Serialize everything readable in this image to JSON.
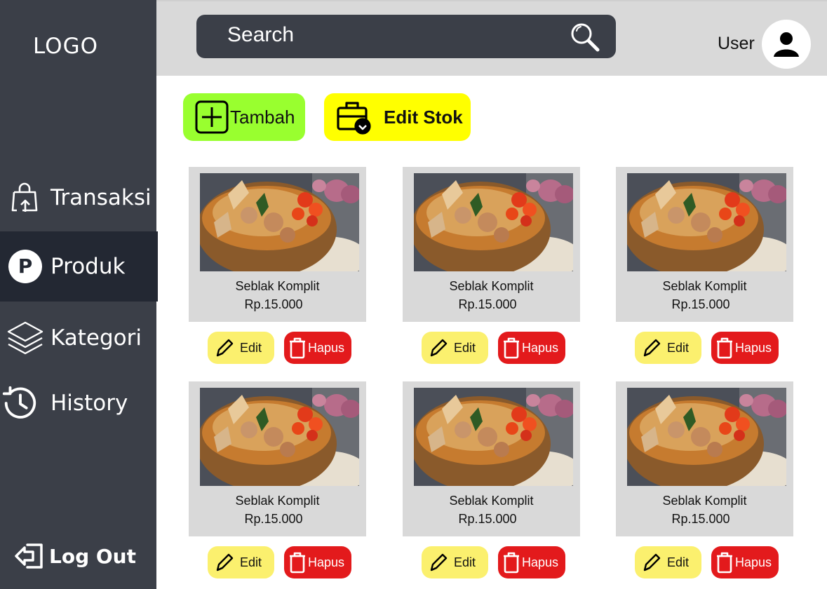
{
  "sidebar": {
    "logo": "LOGO",
    "items": [
      {
        "label": "Transaksi",
        "icon": "shopping-bag-upload-icon"
      },
      {
        "label": "Produk",
        "icon": "p-circle-icon"
      },
      {
        "label": "Kategori",
        "icon": "layers-icon"
      },
      {
        "label": "History",
        "icon": "history-clock-icon"
      }
    ],
    "active": "Produk",
    "logout_label": "Log Out"
  },
  "header": {
    "search_placeholder": "Search",
    "user_label": "User"
  },
  "toolbar": {
    "add_label": "Tambah",
    "edit_stock_label": "Edit Stok"
  },
  "products": [
    {
      "name": "Seblak Komplit",
      "price": "Rp.15.000"
    },
    {
      "name": "Seblak Komplit",
      "price": "Rp.15.000"
    },
    {
      "name": "Seblak Komplit",
      "price": "Rp.15.000"
    },
    {
      "name": "Seblak Komplit",
      "price": "Rp.15.000"
    },
    {
      "name": "Seblak Komplit",
      "price": "Rp.15.000"
    },
    {
      "name": "Seblak Komplit",
      "price": "Rp.15.000"
    }
  ],
  "card_actions": {
    "edit_label": "Edit",
    "delete_label": "Hapus"
  },
  "colors": {
    "sidebar": "#3b3f48",
    "sidebar_active": "#232833",
    "topbar": "#d9d9d9",
    "add_button": "#99ff2f",
    "stock_button": "#ffff00",
    "edit_button": "#fbf06e",
    "delete_button": "#e31a1c"
  }
}
